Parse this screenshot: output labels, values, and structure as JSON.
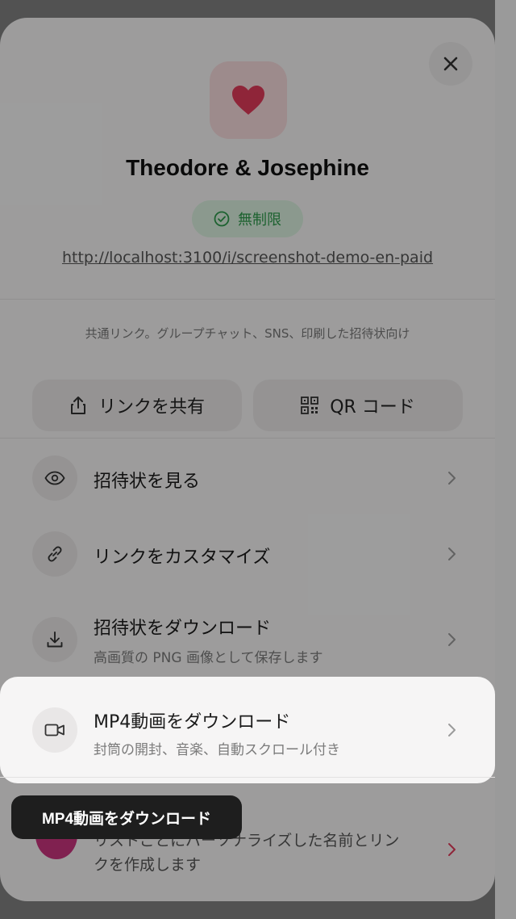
{
  "sheet": {
    "title": "Theodore & Josephine",
    "badge_label": "無制限",
    "url": "http://localhost:3100/i/screenshot-demo-en-paid",
    "share_caption": "共通リンク。グループチャット、SNS、印刷した招待状向け",
    "share_button_label": "リンクを共有",
    "qr_button_label": "QR コード",
    "heart_icon": "heart-icon",
    "accent_color": "#e03a5a",
    "badge_color": "#2e9a4c"
  },
  "menu": [
    {
      "title": "招待状を見る",
      "icon": "eye-icon"
    },
    {
      "title": "リンクをカスタマイズ",
      "icon": "link-icon"
    },
    {
      "title": "招待状をダウンロード",
      "subtitle": "高画質の PNG 画像として保存します",
      "icon": "download-icon"
    },
    {
      "title": "MP4動画をダウンロード",
      "subtitle": "封筒の開封、音楽、自動スクロール付き",
      "icon": "video-camera-icon"
    },
    {
      "subtitle_line1": "リストごとにパーソナライズした名前とリン",
      "subtitle_line2": "クを作成します",
      "icon": "gradient-circle-icon"
    }
  ],
  "tooltip": {
    "label": "MP4動画をダウンロード"
  }
}
